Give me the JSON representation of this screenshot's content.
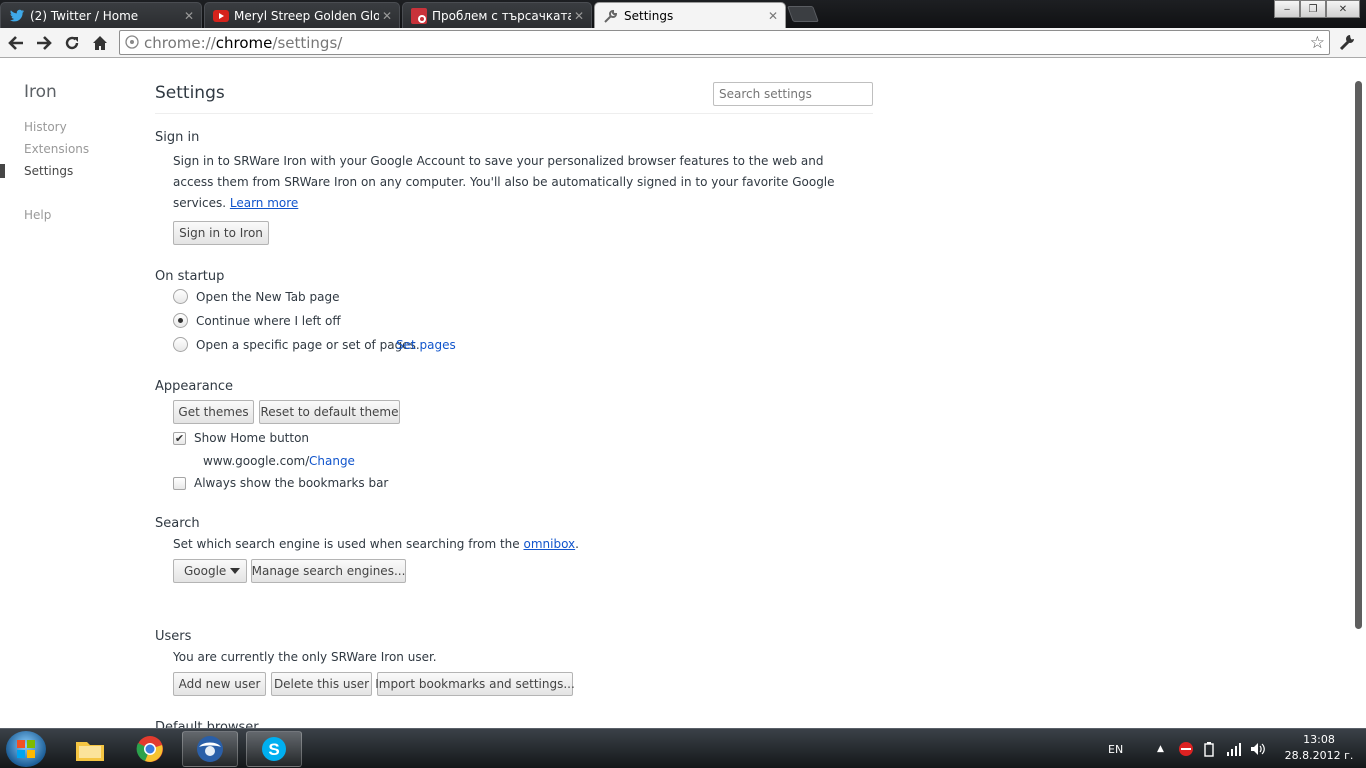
{
  "tabs": [
    {
      "title": "(2) Twitter / Home",
      "icon": "twitter-icon"
    },
    {
      "title": "Meryl Streep Golden Globes",
      "icon": "youtube-icon"
    },
    {
      "title": "Проблем с търсачката",
      "icon": "forum-icon"
    },
    {
      "title": "Settings",
      "icon": "wrench-icon"
    }
  ],
  "window_controls": {
    "minimize": "‒",
    "maximize": "❐",
    "close": "✕"
  },
  "toolbar": {
    "url_scheme": "chrome://",
    "url_host": "chrome",
    "url_path": "/settings/"
  },
  "nav": {
    "brand": "Iron",
    "items": [
      "History",
      "Extensions",
      "Settings",
      "Help"
    ]
  },
  "header": {
    "title": "Settings",
    "search_placeholder": "Search settings"
  },
  "signin": {
    "title": "Sign in",
    "line1": "Sign in to SRWare Iron with your Google Account to save your personalized browser features to the web and",
    "line2": "access them from SRWare Iron on any computer. You'll also be automatically signed in to your favorite Google",
    "line3": "services. ",
    "learn_more": "Learn more",
    "button": "Sign in to Iron"
  },
  "startup": {
    "title": "On startup",
    "options": [
      "Open the New Tab page",
      "Continue where I left off",
      "Open a specific page or set of pages."
    ],
    "selected_index": 1,
    "set_pages": "Set pages"
  },
  "appearance": {
    "title": "Appearance",
    "get_themes": "Get themes",
    "reset_theme": "Reset to default theme",
    "show_home": "Show Home button",
    "show_home_checked": true,
    "home_url": "www.google.com/",
    "change": "Change",
    "bookmarks_bar": "Always show the bookmarks bar",
    "bookmarks_bar_checked": false
  },
  "search": {
    "title": "Search",
    "desc": "Set which search engine is used when searching from the ",
    "omnibox_link": "omnibox",
    "desc_end": ".",
    "engine": "Google",
    "manage": "Manage search engines..."
  },
  "users": {
    "title": "Users",
    "desc": "You are currently the only SRWare Iron user.",
    "add": "Add new user",
    "delete": "Delete this user",
    "import": "Import bookmarks and settings..."
  },
  "default_browser": {
    "title": "Default browser"
  },
  "taskbar": {
    "language": "EN",
    "time": "13:08",
    "date": "28.8.2012 г."
  }
}
